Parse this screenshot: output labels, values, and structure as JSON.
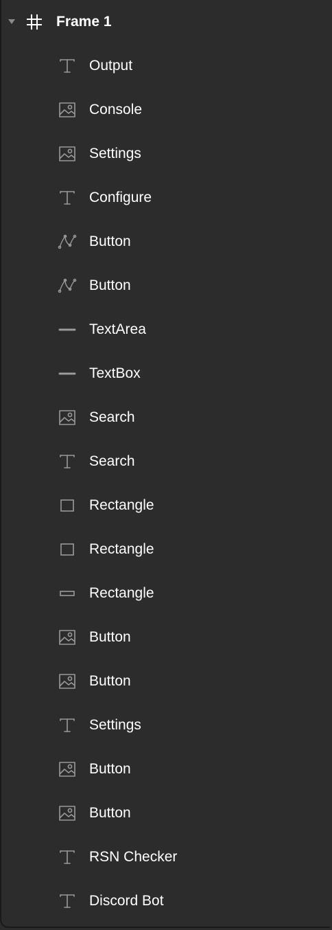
{
  "layers_panel": {
    "frame": {
      "label": "Frame 1",
      "icon": "frame-grid-icon",
      "expanded": true
    },
    "children": [
      {
        "label": "Output",
        "icon": "text-icon"
      },
      {
        "label": "Console",
        "icon": "image-icon"
      },
      {
        "label": "Settings",
        "icon": "image-icon"
      },
      {
        "label": "Configure",
        "icon": "text-icon"
      },
      {
        "label": "Button",
        "icon": "vector-path-icon"
      },
      {
        "label": "Button",
        "icon": "vector-path-icon"
      },
      {
        "label": "TextArea",
        "icon": "line-icon"
      },
      {
        "label": "TextBox",
        "icon": "line-icon"
      },
      {
        "label": "Search",
        "icon": "image-icon"
      },
      {
        "label": "Search",
        "icon": "text-icon"
      },
      {
        "label": "Rectangle",
        "icon": "rectangle-icon"
      },
      {
        "label": "Rectangle",
        "icon": "rectangle-icon"
      },
      {
        "label": "Rectangle",
        "icon": "flat-rectangle-icon"
      },
      {
        "label": "Button",
        "icon": "image-icon"
      },
      {
        "label": "Button",
        "icon": "image-icon"
      },
      {
        "label": "Settings",
        "icon": "text-icon"
      },
      {
        "label": "Button",
        "icon": "image-icon"
      },
      {
        "label": "Button",
        "icon": "image-icon"
      },
      {
        "label": "RSN Checker",
        "icon": "text-icon"
      },
      {
        "label": "Discord Bot",
        "icon": "text-icon"
      }
    ]
  },
  "colors": {
    "panel_background": "#2c2c2c",
    "text": "#ffffff",
    "icon": "#9a9a9a",
    "border": "#1a1a1a"
  }
}
